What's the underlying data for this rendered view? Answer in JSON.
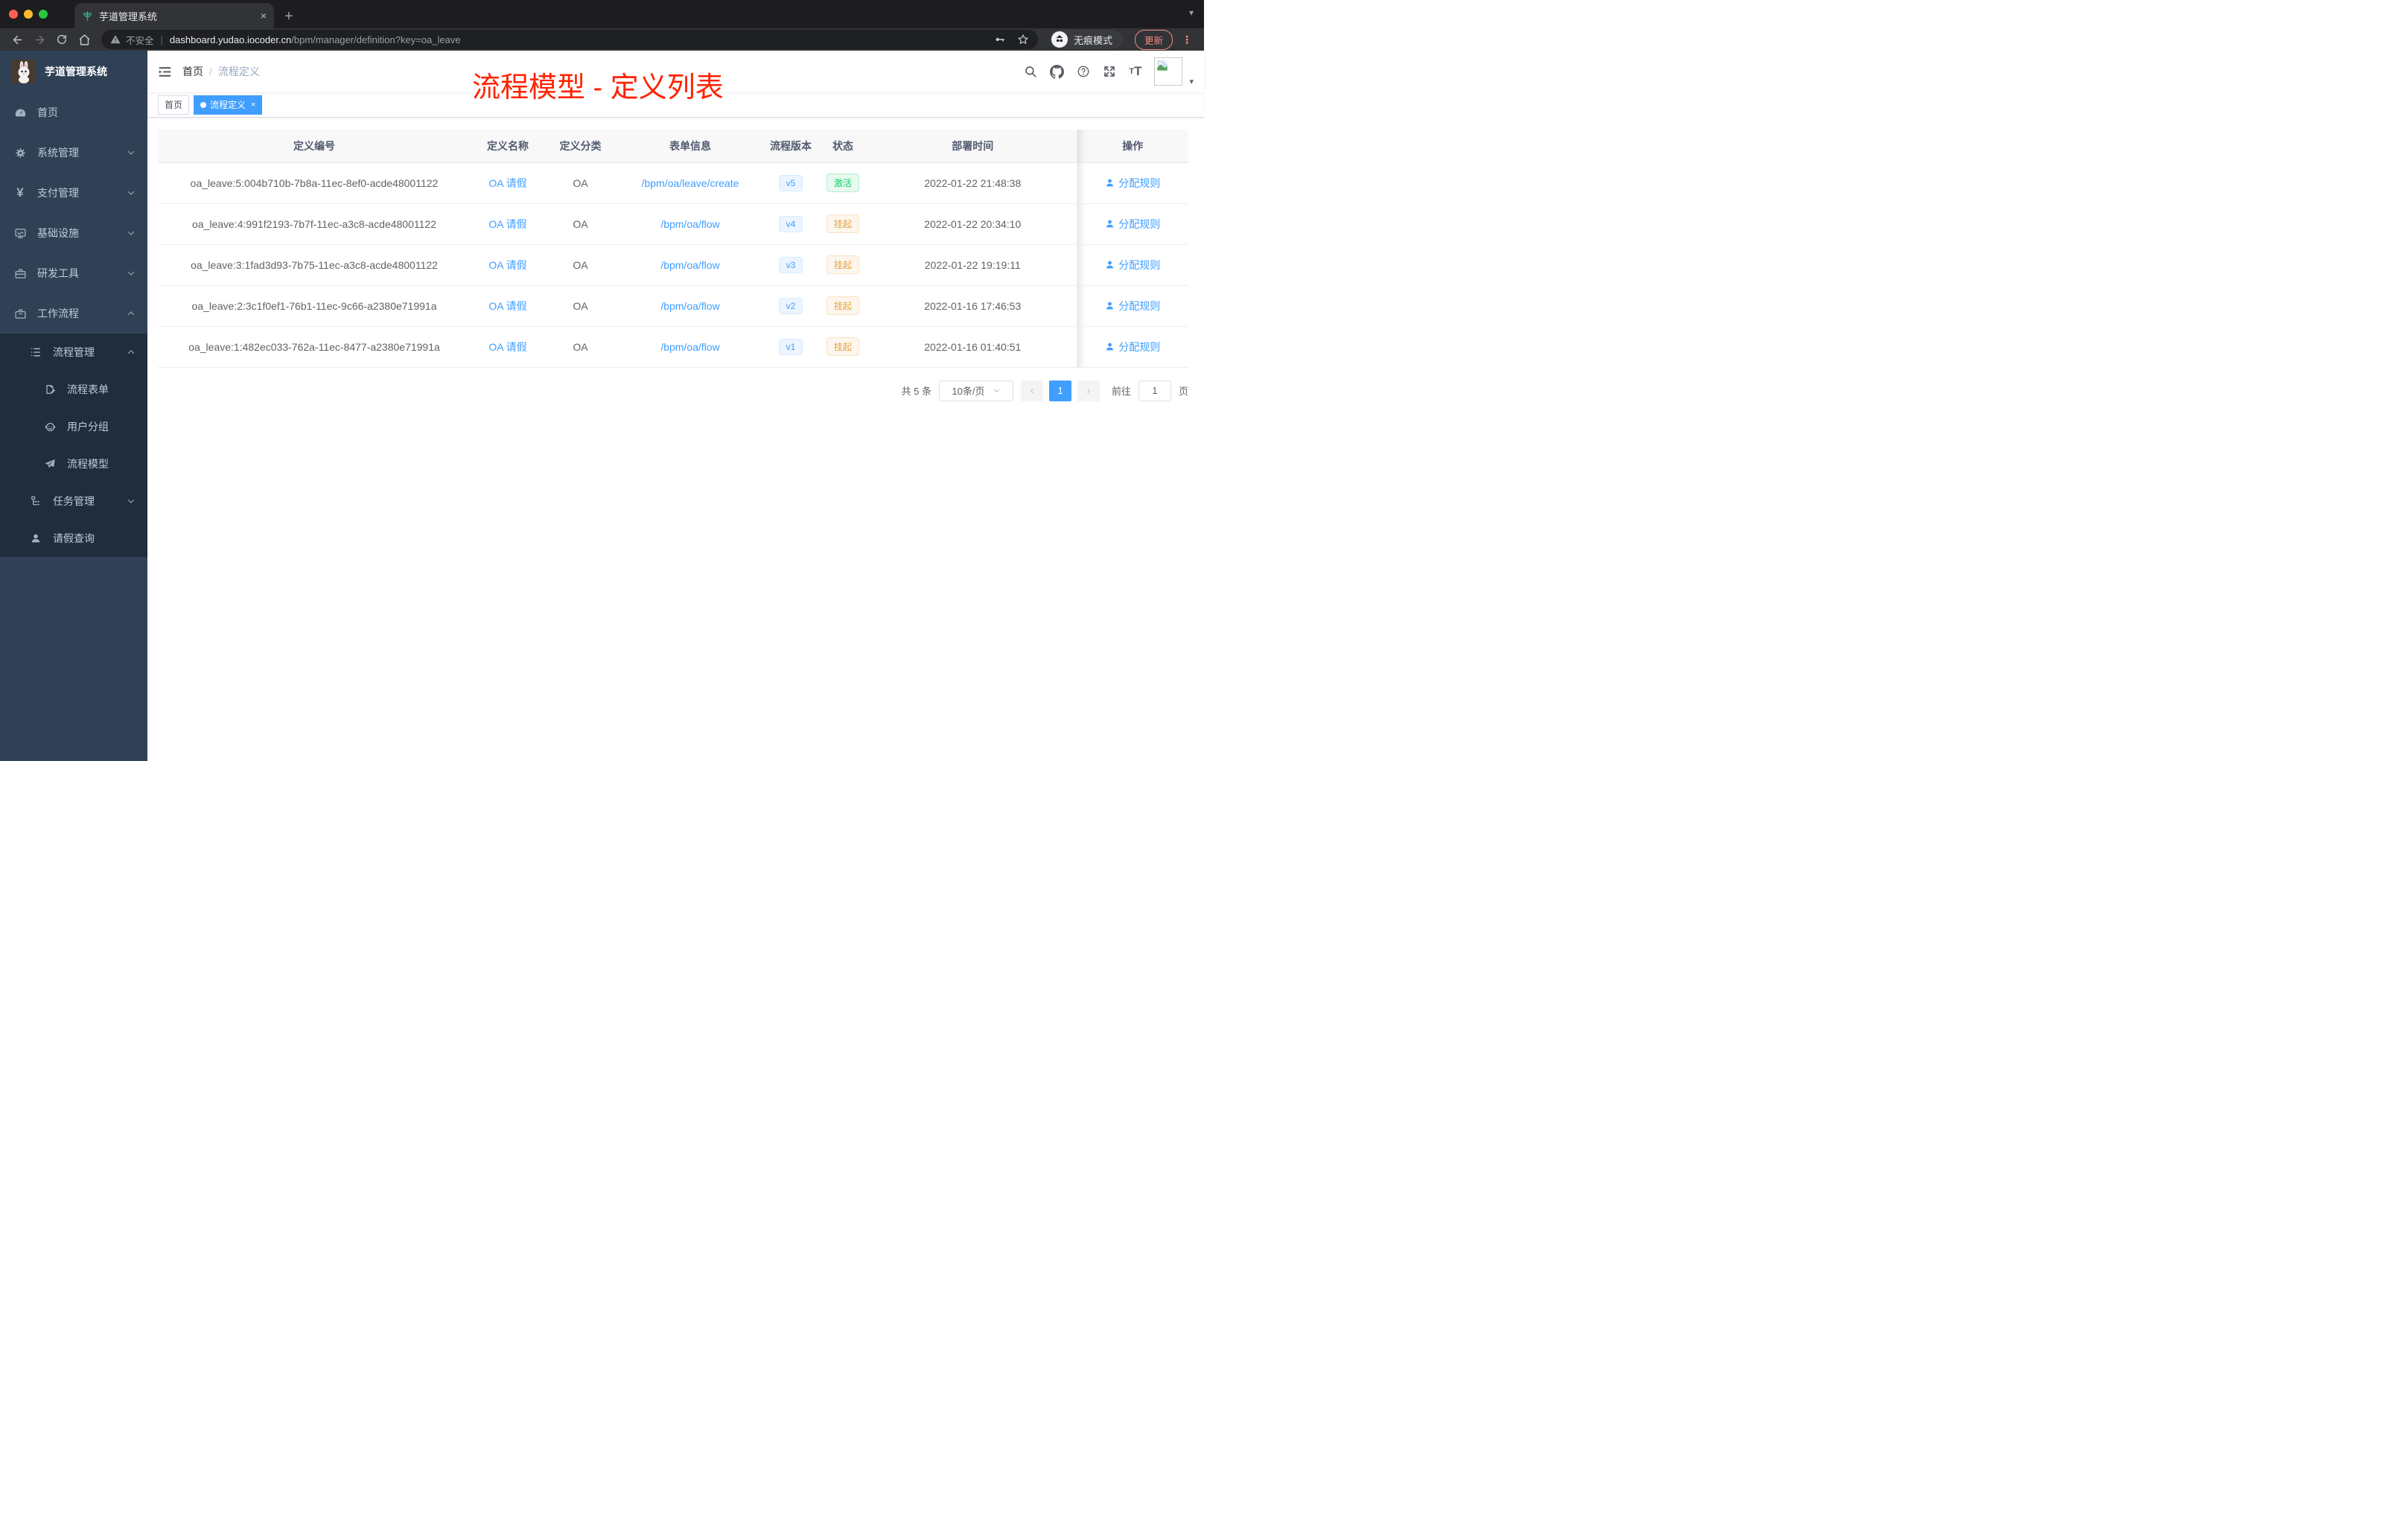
{
  "browser": {
    "tab_title": "芋道管理系统",
    "tab_close": "×",
    "new_tab": "+",
    "security_label": "不安全",
    "url_domain": "dashboard.yudao.iocoder.cn",
    "url_path": "/bpm/manager/definition?key=oa_leave",
    "incognito_label": "无痕模式",
    "update_label": "更新",
    "menu_dots": "⋮"
  },
  "sidebar": {
    "title": "芋道管理系统",
    "items": [
      {
        "label": "首页"
      },
      {
        "label": "系统管理"
      },
      {
        "label": "支付管理"
      },
      {
        "label": "基础设施"
      },
      {
        "label": "研发工具"
      },
      {
        "label": "工作流程"
      },
      {
        "label": "流程管理"
      },
      {
        "label": "流程表单"
      },
      {
        "label": "用户分组"
      },
      {
        "label": "流程模型"
      },
      {
        "label": "任务管理"
      },
      {
        "label": "请假查询"
      }
    ]
  },
  "navbar": {
    "breadcrumb_home": "首页",
    "breadcrumb_sep": "/",
    "breadcrumb_current": "流程定义",
    "overlay_title": "流程模型 - 定义列表"
  },
  "tags": {
    "home": "首页",
    "current": "流程定义",
    "current_close": "×"
  },
  "table": {
    "headers": [
      "定义编号",
      "定义名称",
      "定义分类",
      "表单信息",
      "流程版本",
      "状态",
      "部署时间",
      "操作"
    ],
    "rows": [
      {
        "id": "oa_leave:5:004b710b-7b8a-11ec-8ef0-acde48001122",
        "name": "OA 请假",
        "category": "OA",
        "form": "/bpm/oa/leave/create",
        "version": "v5",
        "status": "激活",
        "status_type": "success",
        "time": "2022-01-22 21:48:38",
        "action": "分配规则"
      },
      {
        "id": "oa_leave:4:991f2193-7b7f-11ec-a3c8-acde48001122",
        "name": "OA 请假",
        "category": "OA",
        "form": "/bpm/oa/flow",
        "version": "v4",
        "status": "挂起",
        "status_type": "warning",
        "time": "2022-01-22 20:34:10",
        "action": "分配规则"
      },
      {
        "id": "oa_leave:3:1fad3d93-7b75-11ec-a3c8-acde48001122",
        "name": "OA 请假",
        "category": "OA",
        "form": "/bpm/oa/flow",
        "version": "v3",
        "status": "挂起",
        "status_type": "warning",
        "time": "2022-01-22 19:19:11",
        "action": "分配规则"
      },
      {
        "id": "oa_leave:2:3c1f0ef1-76b1-11ec-9c66-a2380e71991a",
        "name": "OA 请假",
        "category": "OA",
        "form": "/bpm/oa/flow",
        "version": "v2",
        "status": "挂起",
        "status_type": "warning",
        "time": "2022-01-16 17:46:53",
        "action": "分配规则"
      },
      {
        "id": "oa_leave:1:482ec033-762a-11ec-8477-a2380e71991a",
        "name": "OA 请假",
        "category": "OA",
        "form": "/bpm/oa/flow",
        "version": "v1",
        "status": "挂起",
        "status_type": "warning",
        "time": "2022-01-16 01:40:51",
        "action": "分配规则"
      }
    ]
  },
  "pagination": {
    "total": "共 5 条",
    "page_size": "10条/页",
    "prev": "‹",
    "current_page": "1",
    "next": "›",
    "goto_label": "前往",
    "goto_value": "1",
    "page_label": "页"
  },
  "colors": {
    "accent_blue": "#409eff",
    "annotation_red": "#ff2200",
    "status_active_green": "#13ce66",
    "status_suspend_orange": "#e6a23c",
    "sidebar_bg": "#304156",
    "submenu_bg": "#1f2d3d"
  }
}
